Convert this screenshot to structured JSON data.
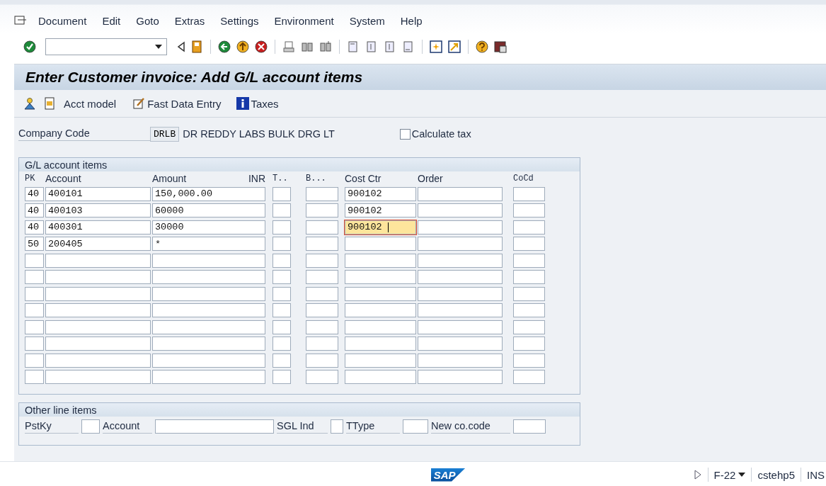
{
  "menu": [
    "Document",
    "Edit",
    "Goto",
    "Extras",
    "Settings",
    "Environment",
    "System",
    "Help"
  ],
  "title": "Enter Customer invoice: Add G/L account items",
  "app_toolbar": [
    {
      "kind": "icon_person"
    },
    {
      "kind": "icon_save"
    },
    {
      "kind": "text",
      "label": "Acct model"
    },
    {
      "kind": "icon_edit",
      "label": "Fast Data Entry"
    },
    {
      "kind": "icon_info",
      "label": "Taxes"
    }
  ],
  "company_code": {
    "label": "Company Code",
    "value": "DRLB",
    "name": "DR REDDY LABS BULK DRG LT"
  },
  "calculate_tax": {
    "label": "Calculate tax",
    "checked": false
  },
  "gl_items": {
    "title": "G/L account items",
    "columns": [
      "PK",
      "Account",
      "Amount",
      "INR",
      "T..",
      "B...",
      "Cost Ctr",
      "Order",
      "CoCd"
    ],
    "rows": [
      {
        "pk": "40",
        "account": "400101",
        "amount": "150,000.00",
        "cost_ctr": "900102",
        "focused": false
      },
      {
        "pk": "40",
        "account": "400103",
        "amount": "60000",
        "cost_ctr": "900102",
        "focused": false
      },
      {
        "pk": "40",
        "account": "400301",
        "amount": "30000",
        "cost_ctr": "900102",
        "focused": true
      },
      {
        "pk": "50",
        "account": "200405",
        "amount": "*",
        "focused": false
      },
      {
        "focused": false
      },
      {
        "focused": false
      },
      {
        "focused": false
      },
      {
        "focused": false
      },
      {
        "focused": false
      },
      {
        "focused": false
      },
      {
        "focused": false
      },
      {
        "focused": false
      }
    ]
  },
  "other_items": {
    "title": "Other line items",
    "fields": [
      "PstKy",
      "Account",
      "SGL Ind",
      "TType",
      "New co.code"
    ]
  },
  "status": {
    "logo": "SAP",
    "transaction": "F-22",
    "server": "cstehp5",
    "mode": "INS"
  }
}
